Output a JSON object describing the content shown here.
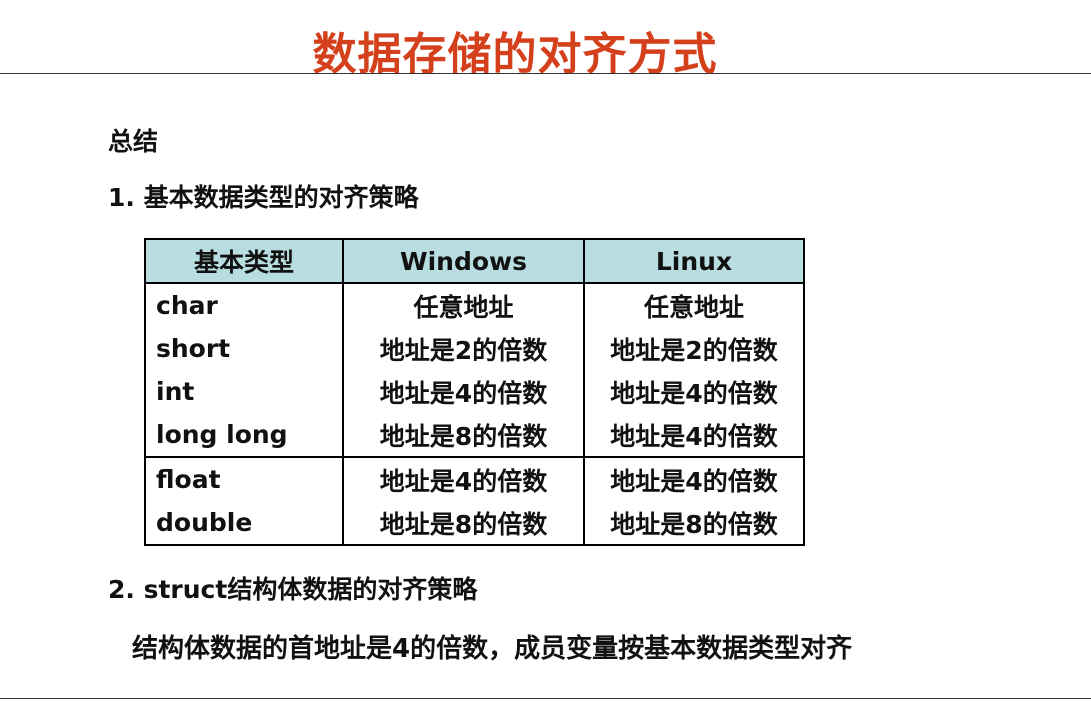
{
  "title": "数据存储的对齐方式",
  "summary_label": "总结",
  "section1": "1. 基本数据类型的对齐策略",
  "table": {
    "headers": [
      "基本类型",
      "Windows",
      "Linux"
    ],
    "rows": [
      {
        "type": "char",
        "windows": "任意地址",
        "linux": "任意地址"
      },
      {
        "type": "short",
        "windows": "地址是2的倍数",
        "linux": "地址是2的倍数"
      },
      {
        "type": "int",
        "windows": "地址是4的倍数",
        "linux": "地址是4的倍数"
      },
      {
        "type": "long long",
        "windows": "地址是8的倍数",
        "linux": "地址是4的倍数"
      },
      {
        "type": "float",
        "windows": "地址是4的倍数",
        "linux": "地址是4的倍数"
      },
      {
        "type": "double",
        "windows": "地址是8的倍数",
        "linux": "地址是8的倍数"
      }
    ]
  },
  "section2": "2. struct结构体数据的对齐策略",
  "section2_body": "结构体数据的首地址是4的倍数，成员变量按基本数据类型对齐",
  "colors": {
    "title": "#d4401c",
    "header_bg": "#b7dde1"
  }
}
